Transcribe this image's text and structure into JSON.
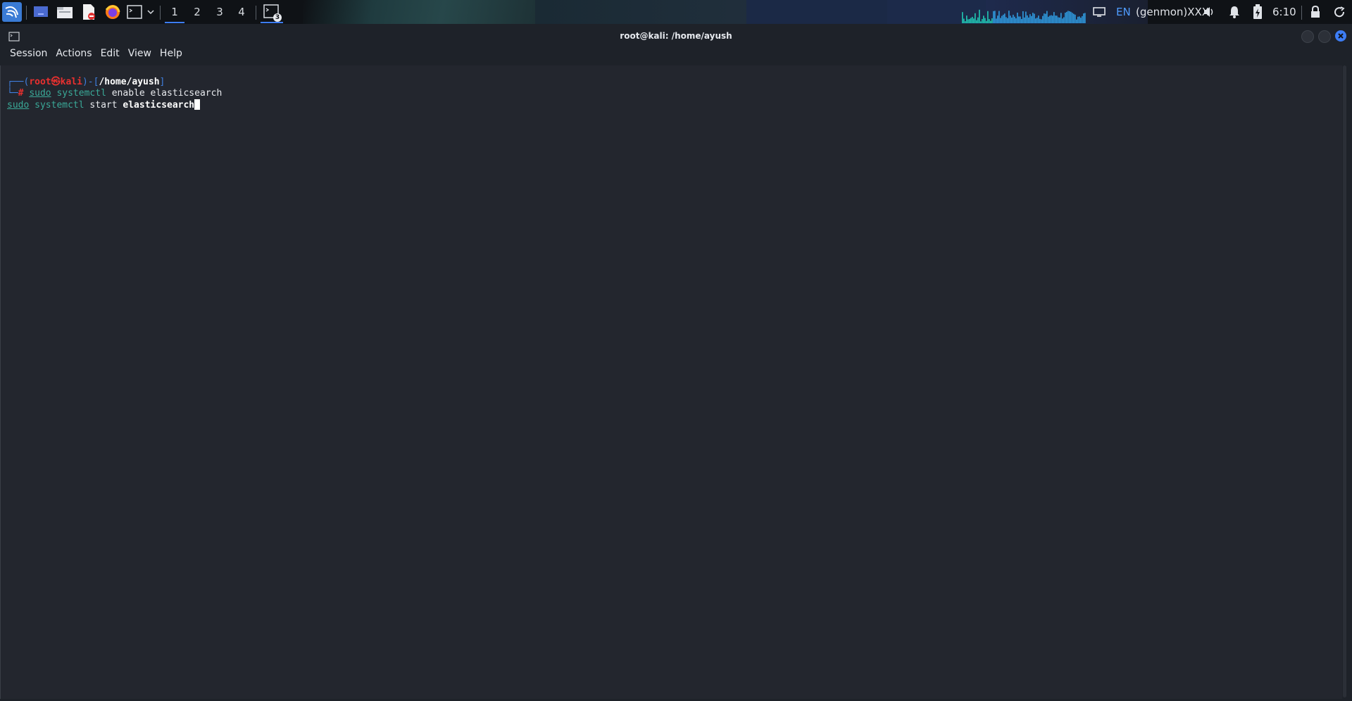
{
  "panel": {
    "workspaces": [
      "1",
      "2",
      "3",
      "4"
    ],
    "active_workspace": "1",
    "task_badge": "3",
    "language": "EN",
    "genmon": "(genmon)XXX",
    "clock": "6:10",
    "icons": [
      "kali-menu-icon",
      "desktop-icon",
      "file-manager-icon",
      "text-editor-icon",
      "firefox-icon",
      "terminal-icon",
      "chevron-down-icon"
    ]
  },
  "window": {
    "title": "root@kali: /home/ayush",
    "close_color": "#3d7df5"
  },
  "menu": {
    "session": "Session",
    "actions": "Actions",
    "edit": "Edit",
    "view": "View",
    "help": "Help"
  },
  "terminal": {
    "prompt": {
      "corner_top": "┌──(",
      "user": "root",
      "at": "㉿",
      "host": "kali",
      "bracket_mid": ")-[",
      "path": "/home/ayush",
      "bracket_end": "]",
      "corner_bottom": "└─",
      "hash": "#"
    },
    "line1": {
      "sudo": "sudo",
      "cmd": "systemctl",
      "args": "enable elasticsearch"
    },
    "line2": {
      "sudo": "sudo",
      "cmd": "systemctl",
      "arg1": "start",
      "arg2": "elasticsearch"
    }
  }
}
